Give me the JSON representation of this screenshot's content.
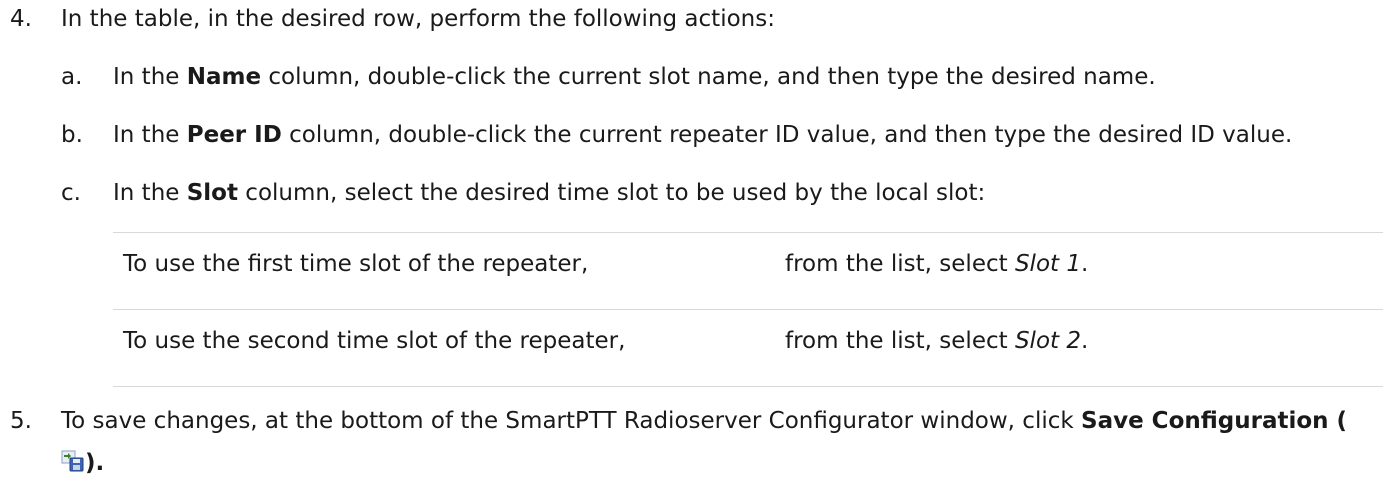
{
  "step4": {
    "number": "4.",
    "text": "In the table, in the desired row, perform the following actions:"
  },
  "substeps": [
    {
      "letter": "a.",
      "pre": "In the ",
      "bold": "Name",
      "post": " column, double-click the current slot name, and then type the desired name."
    },
    {
      "letter": "b.",
      "pre": "In the ",
      "bold": "Peer ID",
      "post": " column, double-click the current repeater ID value, and then type the desired ID value."
    },
    {
      "letter": "c.",
      "pre": "In the ",
      "bold": "Slot",
      "post": " column, select the desired time slot to be used by the local slot:"
    }
  ],
  "table": {
    "rows": [
      {
        "condition": "To use the first time slot of the repeater,",
        "action_pre": "from the list, select ",
        "action_italic": "Slot 1",
        "action_post": "."
      },
      {
        "condition": "To use the second time slot of the repeater,",
        "action_pre": "from the list, select ",
        "action_italic": "Slot 2",
        "action_post": "."
      }
    ]
  },
  "step5": {
    "number": "5.",
    "pre": "To save changes, at the bottom of the SmartPTT Radioserver Configurator window, click ",
    "bold": "Save Configuration (",
    "icon": "save-configuration-icon",
    "close": ")."
  }
}
